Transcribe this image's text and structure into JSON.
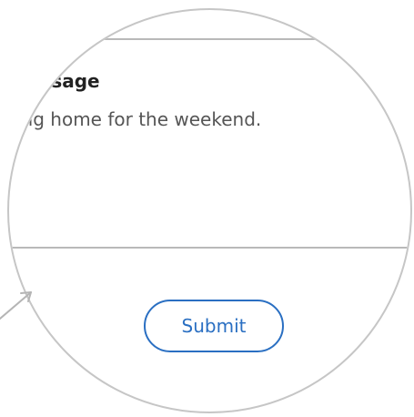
{
  "form": {
    "message_label": "lessage",
    "message_text": "ing home for the weekend.",
    "submit_label": "Submit"
  },
  "colors": {
    "accent": "#2a6fc2",
    "ring": "#c6c6c6",
    "divider": "#b9b9b9",
    "label_text": "#222222",
    "body_text": "#555555"
  },
  "icons": {
    "pointer": "magnifier-pointer-icon"
  }
}
